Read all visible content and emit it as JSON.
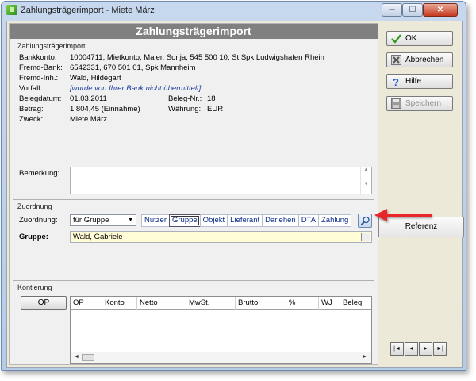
{
  "window": {
    "title": "Zahlungsträgerimport - Miete März",
    "buttons": [
      "─",
      "☐",
      "✕"
    ]
  },
  "header": {
    "title": "Zahlungsträgerimport"
  },
  "section_zahlungstraeger": {
    "label": "Zahlungsträgerimport",
    "fields": [
      {
        "label": "Bankkonto:",
        "value": "10004711,  Mietkonto,  Maier, Sonja,  545 500 10,  St Spk Ludwigshafen Rhein"
      },
      {
        "label": "Fremd-Bank:",
        "value": "6542331,  670 501 01,  Spk Mannheim"
      },
      {
        "label": "Fremd-Inh.:",
        "value": "Wald, Hildegart"
      },
      {
        "label": "Vorfall:",
        "value": "[wurde von Ihrer Bank nicht übermittelt]"
      },
      {
        "label": "Belegdatum:",
        "value": "01.03.2011"
      },
      {
        "label": "Betrag:",
        "value": "1.804,45 (Einnahme)"
      },
      {
        "label": "Zweck:",
        "value": "Miete März"
      }
    ],
    "beleg_nr": {
      "label": "Beleg-Nr.:",
      "value": "18"
    },
    "waehrung": {
      "label": "Währung:",
      "value": "EUR"
    },
    "bemerkung_label": "Bemerkung:"
  },
  "section_zuordnung": {
    "label": "Zuordnung",
    "zuordnung_label": "Zuordnung:",
    "select_value": "für Gruppe",
    "tabs": [
      "Nutzer",
      "Gruppe",
      "Objekt",
      "Lieferant",
      "Darlehen",
      "DTA",
      "Zahlung"
    ],
    "active_tab": "Gruppe",
    "gruppe_label": "Gruppe:",
    "gruppe_value": "Wald, Gabriele",
    "dots": "..."
  },
  "section_kontierung": {
    "label": "Kontierung",
    "op_button": "OP",
    "columns": [
      "OP",
      "Konto",
      "Netto",
      "MwSt.",
      "Brutto",
      "%",
      "WJ",
      "Beleg"
    ]
  },
  "right_buttons": {
    "ok": "OK",
    "abbrechen": "Abbrechen",
    "hilfe": "Hilfe",
    "speichern": "Speichern",
    "referenz": "Referenz"
  },
  "nav_buttons": [
    "|◄",
    "◄",
    "►",
    "►|"
  ],
  "icons": {
    "ok": "checkmark-icon",
    "abbrechen": "cancel-icon",
    "hilfe": "help-icon",
    "speichern": "save-icon",
    "search": "search-icon",
    "app": "app-icon"
  },
  "colors": {
    "arrow": "#e8252b",
    "header_bar": "#808080",
    "group_field": "#fffcd6",
    "tab_text": "#0b2d8a"
  }
}
